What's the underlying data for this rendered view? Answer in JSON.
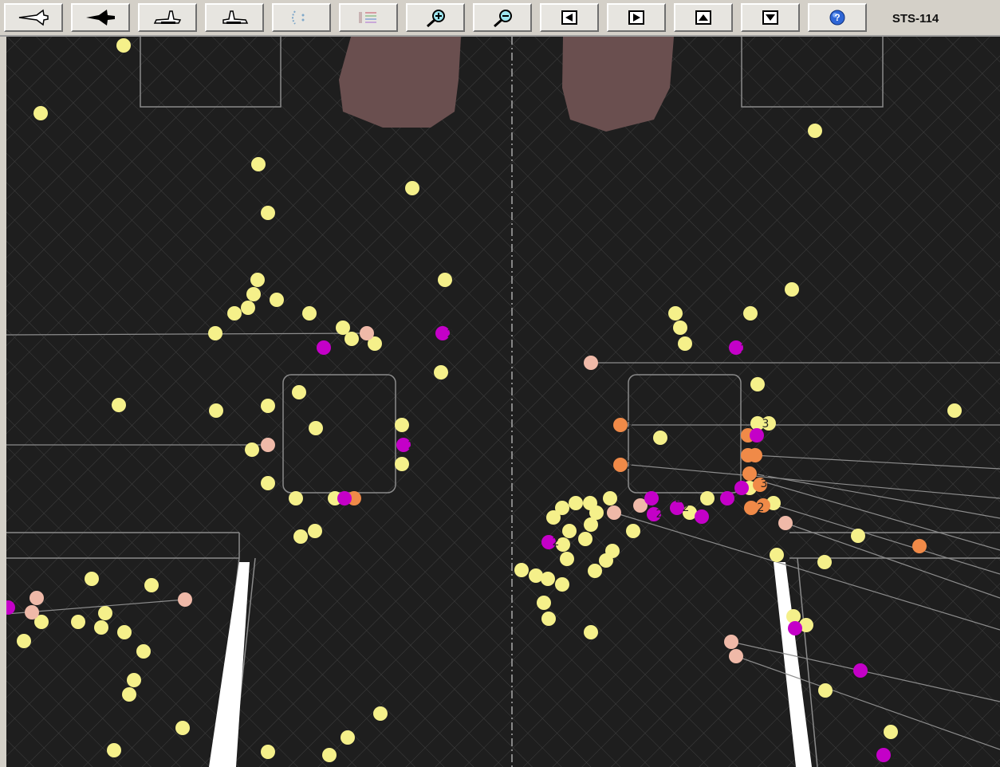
{
  "header": {
    "mission": "STS-114"
  },
  "toolbar": {
    "buttons": [
      {
        "name": "side-view-button",
        "icon": "orbiter-side-icon"
      },
      {
        "name": "top-view-button",
        "icon": "orbiter-top-icon"
      },
      {
        "name": "left-side-view-button",
        "icon": "orbiter-left-icon"
      },
      {
        "name": "right-side-view-button",
        "icon": "orbiter-right-icon"
      },
      {
        "name": "selection-tool-button",
        "icon": "dotted-select-icon"
      },
      {
        "name": "legend-toggle-button",
        "icon": "legend-list-icon"
      },
      {
        "name": "zoom-in-button",
        "icon": "zoom-in-icon"
      },
      {
        "name": "zoom-out-button",
        "icon": "zoom-out-icon"
      },
      {
        "name": "pan-left-button",
        "icon": "arrow-left-icon"
      },
      {
        "name": "pan-right-button",
        "icon": "arrow-right-icon"
      },
      {
        "name": "pan-up-button",
        "icon": "arrow-up-icon"
      },
      {
        "name": "pan-down-button",
        "icon": "arrow-down-icon"
      },
      {
        "name": "help-button",
        "icon": "help-icon"
      }
    ]
  },
  "colors": {
    "background": "#1e1e1e",
    "tile_grid": "#3e3e3e",
    "structure_outline": "#8a8a8a",
    "door_panel": "#6a4f4f",
    "hit_small": "#f5f08a",
    "hit_pink": "#efb9a8",
    "hit_magenta": "#c400c8",
    "hit_orange": "#f08a48",
    "leader_line": "#8c8c8c",
    "stripe": "#ffffff"
  },
  "impact_labels": [
    "2",
    "3",
    "6"
  ]
}
